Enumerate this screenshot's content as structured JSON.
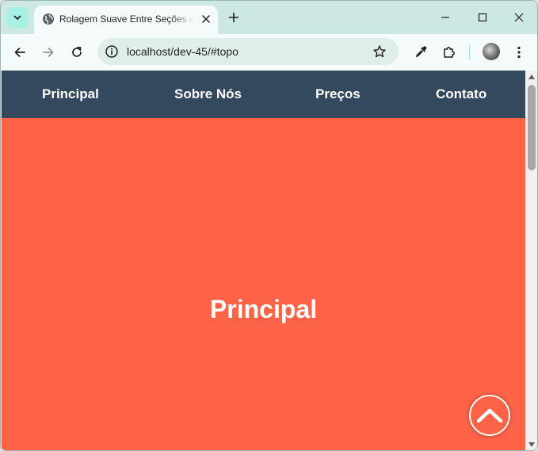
{
  "browser": {
    "tab": {
      "title": "Rolagem Suave Entre Seções da Página"
    },
    "address_bar": {
      "url": "localhost/dev-45/#topo"
    }
  },
  "page": {
    "nav": {
      "items": [
        {
          "label": "Principal"
        },
        {
          "label": "Sobre Nós"
        },
        {
          "label": "Preços"
        },
        {
          "label": "Contato"
        }
      ]
    },
    "hero": {
      "heading": "Principal"
    },
    "colors": {
      "nav_background": "#34495e",
      "section_background": "#ff6347",
      "text": "#ffffff"
    },
    "icons": {
      "scroll_top": "chevron-up-icon"
    }
  }
}
